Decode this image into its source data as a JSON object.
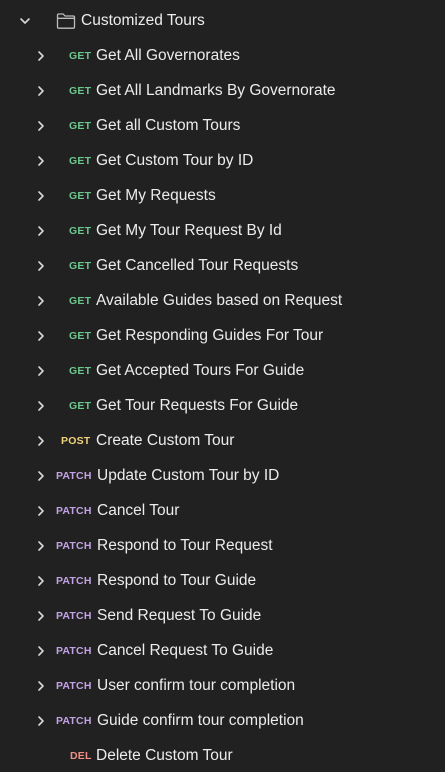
{
  "folder": {
    "name": "Customized Tours",
    "icons": {
      "expand": "chevron-down-icon",
      "folder": "folder-icon"
    }
  },
  "colors": {
    "background": "#212121",
    "text": "#ececec",
    "get": "#6bc88d",
    "post": "#f1d27c",
    "patch": "#c3a3e6",
    "delete": "#f08f86"
  },
  "requests": [
    {
      "method": "GET",
      "name": "Get All Governorates",
      "expandable": true
    },
    {
      "method": "GET",
      "name": "Get All Landmarks By Governorate",
      "expandable": true
    },
    {
      "method": "GET",
      "name": "Get all Custom Tours",
      "expandable": true
    },
    {
      "method": "GET",
      "name": "Get Custom Tour by ID",
      "expandable": true
    },
    {
      "method": "GET",
      "name": "Get My Requests",
      "expandable": true
    },
    {
      "method": "GET",
      "name": "Get My Tour Request By Id",
      "expandable": true
    },
    {
      "method": "GET",
      "name": "Get Cancelled Tour Requests",
      "expandable": true
    },
    {
      "method": "GET",
      "name": "Available Guides based on Request",
      "expandable": true
    },
    {
      "method": "GET",
      "name": "Get Responding Guides For Tour",
      "expandable": true
    },
    {
      "method": "GET",
      "name": "Get Accepted Tours For Guide",
      "expandable": true
    },
    {
      "method": "GET",
      "name": "Get Tour Requests For Guide",
      "expandable": true
    },
    {
      "method": "POST",
      "name": "Create Custom Tour",
      "expandable": true
    },
    {
      "method": "PATCH",
      "name": "Update Custom Tour by ID",
      "expandable": true
    },
    {
      "method": "PATCH",
      "name": "Cancel Tour",
      "expandable": true
    },
    {
      "method": "PATCH",
      "name": "Respond to Tour Request",
      "expandable": true
    },
    {
      "method": "PATCH",
      "name": "Respond to Tour Guide",
      "expandable": true
    },
    {
      "method": "PATCH",
      "name": "Send Request To Guide",
      "expandable": true
    },
    {
      "method": "PATCH",
      "name": "Cancel Request To Guide",
      "expandable": true
    },
    {
      "method": "PATCH",
      "name": "User confirm tour completion",
      "expandable": true
    },
    {
      "method": "PATCH",
      "name": "Guide confirm tour completion",
      "expandable": true
    },
    {
      "method": "DEL",
      "name": "Delete Custom Tour",
      "expandable": false
    }
  ]
}
